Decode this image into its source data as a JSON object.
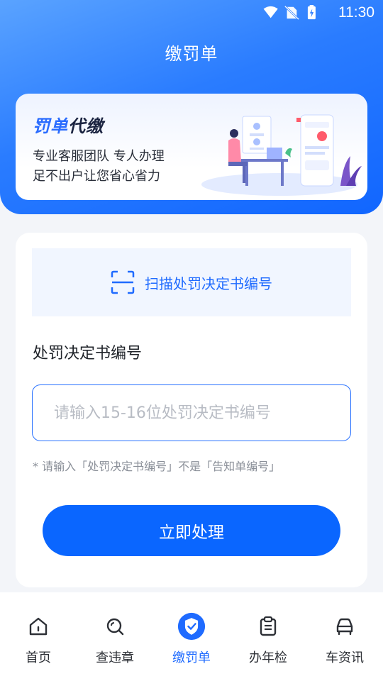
{
  "status_bar": {
    "time": "11:30"
  },
  "header": {
    "title": "缴罚单"
  },
  "banner": {
    "title_part1": "罚单",
    "title_part2": "代缴",
    "line1": "专业客服团队 专人办理",
    "line2": "足不出户让您省心省力"
  },
  "form": {
    "scan_label": "扫描处罚决定书编号",
    "field_label": "处罚决定书编号",
    "input_placeholder": "请输入15-16位处罚决定书编号",
    "input_value": "",
    "hint": "* 请输入「处罚决定书编号」不是「告知单编号」",
    "submit_label": "立即处理"
  },
  "tabbar": {
    "items": [
      {
        "label": "首页",
        "icon": "home-icon",
        "active": false
      },
      {
        "label": "查违章",
        "icon": "search-icon",
        "active": false
      },
      {
        "label": "缴罚单",
        "icon": "shield-check-icon",
        "active": true
      },
      {
        "label": "办年检",
        "icon": "clipboard-icon",
        "active": false
      },
      {
        "label": "车资讯",
        "icon": "car-icon",
        "active": false
      }
    ]
  },
  "colors": {
    "accent": "#1f6bff",
    "button": "#0a66ff",
    "header_gradient_start": "#5aa3ff",
    "header_gradient_end": "#1166ff"
  }
}
